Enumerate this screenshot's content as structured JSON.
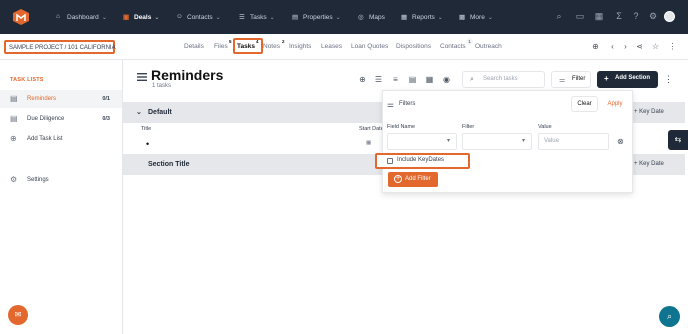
{
  "colors": {
    "accent": "#e2682e",
    "nav_bg": "#1f2937",
    "section_bg": "#e5e7eb",
    "help": "#0e7490"
  },
  "nav": {
    "items": [
      {
        "label": "Dashboard",
        "icon": "home-icon",
        "chev": true
      },
      {
        "label": "Deals",
        "icon": "briefcase-icon",
        "chev": true,
        "active": true
      },
      {
        "label": "Contacts",
        "icon": "users-icon",
        "chev": true
      },
      {
        "label": "Tasks",
        "icon": "tasks-icon",
        "chev": true
      },
      {
        "label": "Properties",
        "icon": "building-icon",
        "chev": true
      },
      {
        "label": "Maps",
        "icon": "globe-icon",
        "chev": false
      },
      {
        "label": "Reports",
        "icon": "report-icon",
        "chev": true
      },
      {
        "label": "More",
        "icon": "grid-icon",
        "chev": true
      }
    ],
    "chevron": "⌄"
  },
  "project": {
    "label": "SAMPLE PROJECT / 101 CALIFORNIA"
  },
  "tabs": [
    {
      "label": "Details"
    },
    {
      "label": "Files",
      "count": "5"
    },
    {
      "label": "Tasks",
      "count": "4",
      "active": true
    },
    {
      "label": "Notes",
      "count": "2"
    },
    {
      "label": "Insights"
    },
    {
      "label": "Leases"
    },
    {
      "label": "Loan Quotes"
    },
    {
      "label": "Dispositions"
    },
    {
      "label": "Contacts",
      "count": "1"
    },
    {
      "label": "Outreach"
    }
  ],
  "sidebar": {
    "title": "TASK LISTS",
    "items": [
      {
        "label": "Reminders",
        "count": "0/1",
        "icon": "list-icon",
        "active": true
      },
      {
        "label": "Due Diligence",
        "count": "0/3",
        "icon": "list-icon"
      },
      {
        "label": "Add Task List",
        "icon": "plus-circle-icon"
      },
      {
        "label": "Settings",
        "icon": "gear-icon"
      }
    ]
  },
  "main": {
    "title": "Reminders",
    "subtitle": "1 tasks",
    "search_placeholder": "Search tasks",
    "filter_label": "Filter",
    "add_section_label": "Add Section",
    "sections": [
      {
        "title": "Default",
        "key_date": "Key Date",
        "col_title": "Title",
        "col_start": "Start Date",
        "task_bullet": "•"
      },
      {
        "title": "Section Title",
        "key_date": "Key Date"
      }
    ]
  },
  "filter_panel": {
    "title": "Filters",
    "clear": "Clear",
    "apply": "Apply",
    "field_name_label": "Field Name",
    "filter_label": "Filter",
    "value_label": "Value",
    "value_placeholder": "Value",
    "include_keydates": "Include KeyDates",
    "add_filter": "Add Filter"
  }
}
